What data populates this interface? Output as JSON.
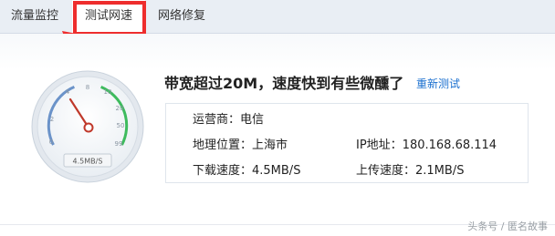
{
  "tabs": [
    {
      "label": "流量监控"
    },
    {
      "label": "测试网速"
    },
    {
      "label": "网络修复"
    }
  ],
  "gauge": {
    "scale_labels": [
      "0",
      "2",
      "4",
      "8",
      "10",
      "20",
      "50",
      "99"
    ],
    "readout": "4.5MB/S",
    "needle_value": "4.5"
  },
  "result": {
    "headline": "带宽超过20M，速度快到有些微醺了",
    "retest_label": "重新测试",
    "isp": "运营商：电信",
    "location": "地理位置：上海市",
    "ip": "IP地址：180.168.68.114",
    "download": "下载速度：4.5MB/S",
    "upload": "上传速度：2.1MB/S"
  },
  "watermark": "头条号 / 匿名故事",
  "colors": {
    "highlight": "#ee2d2d",
    "link": "#1a6fcf",
    "needle": "#c0392b",
    "arc_green": "#3dbb5d",
    "arc_blue": "#6b93c9"
  }
}
